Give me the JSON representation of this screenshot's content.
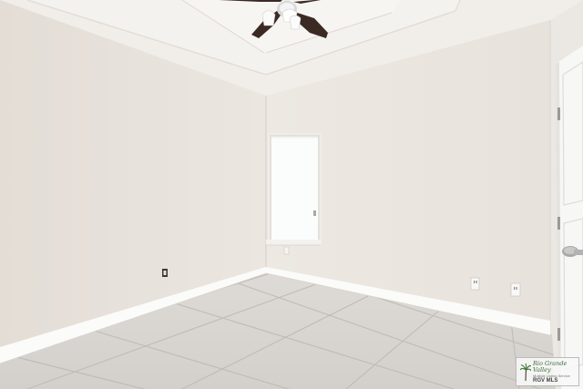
{
  "scene": {
    "description_alt": "",
    "colors": {
      "ceiling": "#f1eee9",
      "wall_left": "#e7e1db",
      "wall_back": "#ebe5df",
      "wall_right": "#ebe7e2",
      "floor": "#d9d6d2",
      "grout": "#bcb8b3",
      "baseboard": "#fafafa",
      "window_glass": "#fbfdfd",
      "fan_blade": "#3b2a24",
      "door": "#f7f7f5"
    },
    "icons": [
      "ceiling-fan-icon",
      "palm-tree-icon",
      "door-handle-icon",
      "outlet-icon"
    ]
  },
  "watermark": {
    "brand": "Rio Grande Valley",
    "tagline": "Multiple Listing Service",
    "mls": "RGV MLS"
  }
}
